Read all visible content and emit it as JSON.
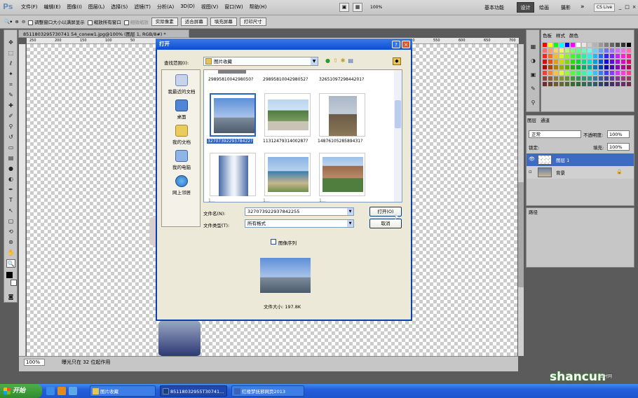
{
  "app": {
    "logo": "Ps"
  },
  "menus": [
    "文件(F)",
    "编辑(E)",
    "图像(I)",
    "图层(L)",
    "选择(S)",
    "滤镜(T)",
    "分析(A)",
    "3D(D)",
    "视图(V)",
    "窗口(W)",
    "帮助(H)"
  ],
  "zoom_display": "100%",
  "workspaces": {
    "basic": "基本功能",
    "design": "设计",
    "paint": "绘画",
    "photo": "摄影",
    "more": "»",
    "cs_live": "CS Live"
  },
  "window_buttons": [
    "_",
    "□",
    "×"
  ],
  "options": {
    "resize_windows": "调整窗口大小以满屏显示",
    "zoom_all": "缩放所有窗口",
    "scrubby": "细微缩放",
    "actual_pixels": "实际像素",
    "fit_screen": "适合屏幕",
    "fill_screen": "填充屏幕",
    "print_size": "打印尺寸"
  },
  "document": {
    "tab": "8511803295730741 54_conew1.jpg@100% (图层 1, RGB/8#) *",
    "ruler_marks": [
      "250",
      "200",
      "150",
      "100",
      "50",
      "0",
      "50",
      "100",
      "150",
      "200",
      "250",
      "300",
      "350",
      "400",
      "450",
      "500",
      "550",
      "600",
      "650",
      "700"
    ],
    "zoom": "100%",
    "status": "曝光只在 32 位起作用"
  },
  "swatches": {
    "tabs": [
      "色板",
      "样式",
      "颜色"
    ]
  },
  "layers": {
    "tabs": [
      "图层",
      "通道"
    ],
    "blend_mode": "正常",
    "opacity_label": "不透明度:",
    "opacity": "100%",
    "lock_label": "锁定:",
    "fill_label": "填充:",
    "fill": "100%",
    "items": [
      {
        "name": "图层 1"
      },
      {
        "name": "背景"
      }
    ]
  },
  "history": {
    "title": "路径"
  },
  "dialog": {
    "title": "打开",
    "help": "?",
    "close": "×",
    "lookin_label": "查找范围(I):",
    "lookin_value": "图片收藏",
    "places": [
      "我最近的文档",
      "桌面",
      "我的文档",
      "我的电脑",
      "网上邻居"
    ],
    "files_top": [
      "2989581004298050?",
      "2989581004298052?",
      "3265109729844201?"
    ],
    "files": [
      "3270739229378422?",
      "1131247931400287?",
      "1487610528589431?"
    ],
    "files_bottom": [
      "1…",
      "1…",
      "1…"
    ],
    "filename_label": "文件名(N):",
    "filename_value": "327073922937842255",
    "filetype_label": "文件类型(T):",
    "filetype_value": "所有格式",
    "open_button": "打开(O)",
    "cancel_button": "取消",
    "image_sequence": "图像序列",
    "file_size": "文件大小: 197.8K"
  },
  "taskbar": {
    "start": "开始",
    "tasks": [
      "图片收藏",
      "85118032955T30741…",
      "红楼梦抚邪网页2013"
    ]
  },
  "watermark": {
    "main": "shancun",
    "sub": "山村网"
  }
}
